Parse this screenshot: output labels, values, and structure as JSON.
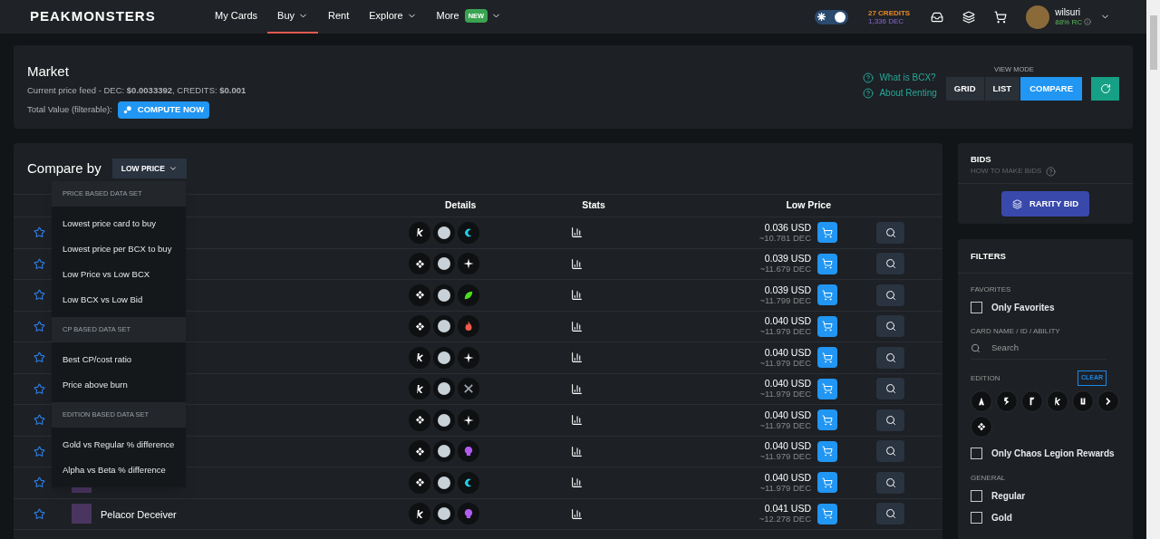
{
  "nav": {
    "logo": "PEAKMONSTERS",
    "items": [
      {
        "label": "My Cards",
        "selected": false,
        "caret": false
      },
      {
        "label": "Buy",
        "selected": true,
        "caret": true
      },
      {
        "label": "Rent",
        "selected": false,
        "caret": false
      },
      {
        "label": "Explore",
        "selected": false,
        "caret": true
      },
      {
        "label": "More",
        "selected": false,
        "caret": true,
        "badge": "NEW"
      }
    ],
    "theme_toggle": {
      "on": true
    },
    "credits": "27 CREDITS",
    "dec": "1,336 DEC",
    "user": {
      "name": "wilsuri",
      "rc": "88% RC"
    }
  },
  "market": {
    "title": "Market",
    "price_feed": "Current price feed - DEC: **$0.0033392**, CREDITS: **$0.001**",
    "total_label": "Total Value (filterable):",
    "compute_button": "COMPUTE NOW",
    "help_links": [
      "What is BCX?",
      "About Renting"
    ],
    "view_mode_label": "VIEW MODE",
    "view_modes": [
      {
        "label": "GRID",
        "selected": false
      },
      {
        "label": "LIST",
        "selected": false
      },
      {
        "label": "COMPARE",
        "selected": true
      }
    ]
  },
  "compare": {
    "title": "Compare by",
    "dropdown": "LOW PRICE",
    "menu": [
      {
        "heading": "PRICE BASED DATA SET",
        "items": [
          "Lowest price card to buy",
          "Lowest price per BCX to buy",
          "Low Price vs Low BCX",
          "Low BCX vs Low Bid"
        ]
      },
      {
        "heading": "CP BASED DATA SET",
        "items": [
          "Best CP/cost ratio",
          "Price above burn"
        ]
      },
      {
        "heading": "EDITION BASED DATA SET",
        "items": [
          "Gold vs Regular % difference",
          "Alpha vs Beta % difference"
        ]
      }
    ],
    "columns": [
      "Details",
      "Stats",
      "Low Price"
    ],
    "rows": [
      {
        "favorite": false,
        "edition": {
          "kind": "arrow"
        },
        "element": {
          "kind": "wave",
          "color": "#22d3ee"
        },
        "usd": "0.036 USD",
        "dec": "~10.781 DEC"
      },
      {
        "favorite": false,
        "edition": {
          "kind": "diamond"
        },
        "element": {
          "kind": "spark",
          "color": "#ffffff"
        },
        "usd": "0.039 USD",
        "dec": "~11.679 DEC"
      },
      {
        "favorite": false,
        "edition": {
          "kind": "diamond"
        },
        "element": {
          "kind": "leaf",
          "color": "#4ade20"
        },
        "usd": "0.039 USD",
        "dec": "~11.799 DEC"
      },
      {
        "favorite": false,
        "edition": {
          "kind": "diamond"
        },
        "element": {
          "kind": "flame",
          "color": "#f05a4a"
        },
        "usd": "0.040 USD",
        "dec": "~11.979 DEC"
      },
      {
        "favorite": false,
        "edition": {
          "kind": "arrow"
        },
        "element": {
          "kind": "spark",
          "color": "#ffffff"
        },
        "usd": "0.040 USD",
        "dec": "~11.979 DEC"
      },
      {
        "favorite": false,
        "edition": {
          "kind": "arrow"
        },
        "element": {
          "kind": "crossed",
          "color": "#9ca3af"
        },
        "usd": "0.040 USD",
        "dec": "~11.979 DEC"
      },
      {
        "favorite": false,
        "edition": {
          "kind": "diamond"
        },
        "element": {
          "kind": "spark",
          "color": "#ffffff"
        },
        "usd": "0.040 USD",
        "dec": "~11.979 DEC"
      },
      {
        "favorite": false,
        "edition": {
          "kind": "diamond"
        },
        "element": {
          "kind": "skull",
          "color": "#b15cf0"
        },
        "usd": "0.040 USD",
        "dec": "~11.979 DEC"
      },
      {
        "favorite": false,
        "edition": {
          "kind": "diamond"
        },
        "element": {
          "kind": "wave",
          "color": "#22d3ee"
        },
        "usd": "0.040 USD",
        "dec": "~11.979 DEC",
        "thumb": true
      },
      {
        "favorite": false,
        "edition": {
          "kind": "arrow"
        },
        "element": {
          "kind": "skull",
          "color": "#b15cf0"
        },
        "name": "Pelacor Deceiver",
        "usd": "0.041 USD",
        "dec": "~12.278 DEC",
        "thumb": true
      }
    ]
  },
  "bids": {
    "title": "BIDS",
    "subtitle": "HOW TO MAKE BIDS",
    "button": "RARITY BID"
  },
  "filters": {
    "title": "FILTERS",
    "favorites_label": "FAVORITES",
    "only_favorites": {
      "label": "Only Favorites",
      "checked": false
    },
    "search_label": "CARD NAME / ID / ABILITY",
    "search_placeholder": "Search",
    "edition_label": "EDITION",
    "clear": "CLEAR",
    "chaos_rewards": {
      "label": "Only Chaos Legion Rewards",
      "checked": false
    },
    "general_label": "GENERAL",
    "general": [
      {
        "label": "Regular",
        "checked": false
      },
      {
        "label": "Gold",
        "checked": false
      }
    ]
  }
}
